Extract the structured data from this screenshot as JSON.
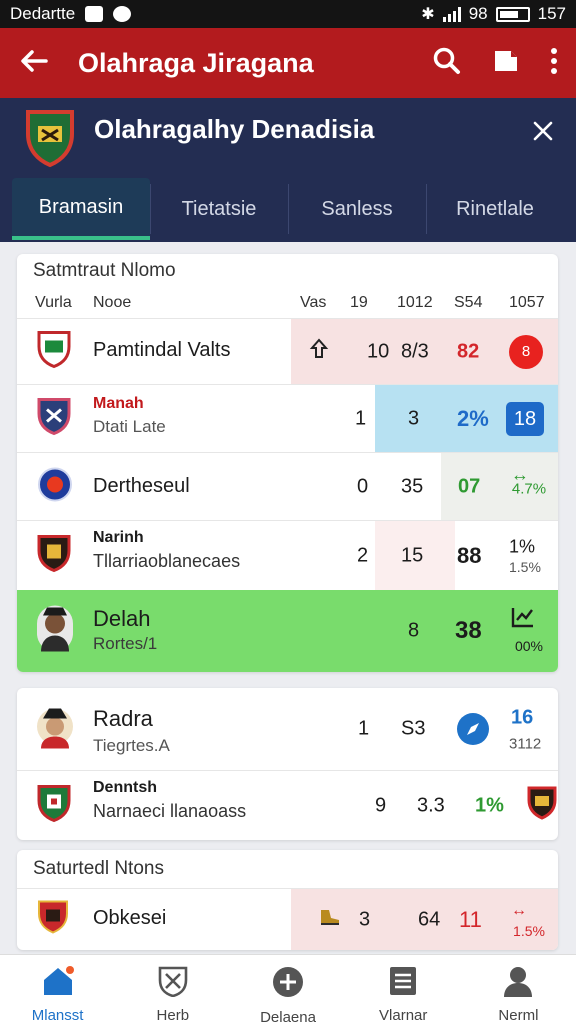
{
  "status_bar": {
    "carrier": "Dedartte",
    "signal_text": "98",
    "battery": "157"
  },
  "app_bar": {
    "title": "Olahraga Jiragana",
    "back_icon": "back-arrow-icon",
    "search_icon": "search-icon",
    "share_icon": "share-icon",
    "menu_icon": "more-vert-icon"
  },
  "team": {
    "name": "Olahragalhy Denadisia"
  },
  "tabs": [
    {
      "label": "Bramasin"
    },
    {
      "label": "Tietatsie"
    },
    {
      "label": "Sanless"
    },
    {
      "label": "Rinetlale"
    }
  ],
  "standings": {
    "title": "Satmtraut Nlomo",
    "headers": {
      "rank": "Vurla",
      "name": "Nooe",
      "c1": "Vas",
      "c2": "19",
      "c3": "1012",
      "c4": "S54",
      "c5": "1057"
    },
    "rows": [
      {
        "name": "Pamtindal Valts",
        "sub": "",
        "c2": "10",
        "c3": "8/3",
        "c4": "82",
        "c5": "8"
      },
      {
        "name": "Manah",
        "sub": "Dtati Late",
        "c2": "1",
        "c3": "3",
        "c4": "2%",
        "c5": "18"
      },
      {
        "name": "Dertheseul",
        "sub": "",
        "c2": "0",
        "c3": "35",
        "c4": "07",
        "c5": "4.7%"
      },
      {
        "name": "Narinh",
        "sub": "Tllarriaoblanecaes",
        "c2": "2",
        "c3": "15",
        "c4": "88",
        "c5": "1%",
        "c5b": "1.5%"
      },
      {
        "name": "Delah",
        "sub": "Rortes/1",
        "c3": "8",
        "c4": "38",
        "c5": "00%"
      }
    ]
  },
  "card2": {
    "rows": [
      {
        "name": "Radra",
        "sub": "Tiegrtes.A",
        "c2": "1",
        "c3": "S3",
        "c5": "16",
        "c5b": "3112"
      },
      {
        "name": "Denntsh",
        "sub": "Narnaeci llanaoass",
        "c2": "9",
        "c3": "3.3",
        "c4": "1%"
      }
    ]
  },
  "card3": {
    "title": "Saturtedl Ntons",
    "rows": [
      {
        "name": "Obkesei",
        "c2": "3",
        "c3": "64",
        "c4": "11",
        "c5": "1.5%"
      }
    ]
  },
  "bottom_nav": [
    {
      "label": "Mlansst",
      "icon": "home-icon"
    },
    {
      "label": "Herb",
      "icon": "shield-icon"
    },
    {
      "label": "Delaena",
      "icon": "add-circle-icon"
    },
    {
      "label": "Vlarnar",
      "icon": "list-icon"
    },
    {
      "label": "Nerml",
      "icon": "profile-icon"
    }
  ],
  "colors": {
    "appbar": "#b31b1e",
    "header": "#232d52",
    "highlight_green": "#79dc6c",
    "accent_blue": "#1e72c8"
  }
}
